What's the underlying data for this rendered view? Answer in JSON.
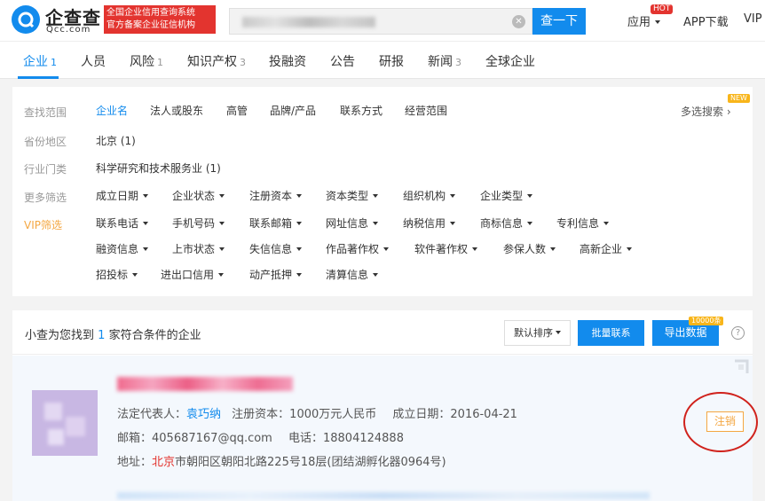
{
  "header": {
    "logo_cn": "企查查",
    "logo_en": "Qcc.com",
    "slogan_line1": "全国企业信用查询系统",
    "slogan_line2": "官方备案企业征信机构",
    "search_button": "查一下",
    "nav": {
      "app": "应用",
      "hot_badge": "HOT",
      "download": "APP下载",
      "vip": "VIP"
    }
  },
  "tabs": [
    {
      "label": "企业",
      "count": "1"
    },
    {
      "label": "人员",
      "count": ""
    },
    {
      "label": "风险",
      "count": "1"
    },
    {
      "label": "知识产权",
      "count": "3"
    },
    {
      "label": "投融资",
      "count": ""
    },
    {
      "label": "公告",
      "count": ""
    },
    {
      "label": "研报",
      "count": ""
    },
    {
      "label": "新闻",
      "count": "3"
    },
    {
      "label": "全球企业",
      "count": ""
    }
  ],
  "filters": {
    "scope_label": "查找范围",
    "scope_items": [
      "企业名",
      "法人或股东",
      "高管",
      "品牌/产品",
      "联系方式",
      "经营范围"
    ],
    "multi_search": "多选搜索",
    "new_badge": "NEW",
    "region_label": "省份地区",
    "region_value": "北京 (1)",
    "industry_label": "行业门类",
    "industry_value": "科学研究和技术服务业 (1)",
    "more_label": "更多筛选",
    "more_items": [
      "成立日期",
      "企业状态",
      "注册资本",
      "资本类型",
      "组织机构",
      "企业类型"
    ],
    "vip_label": "VIP筛选",
    "vip_row1": [
      "联系电话",
      "手机号码",
      "联系邮箱",
      "网址信息",
      "纳税信用",
      "商标信息",
      "专利信息"
    ],
    "vip_row2": [
      "融资信息",
      "上市状态",
      "失信信息",
      "作品著作权",
      "软件著作权",
      "参保人数",
      "高新企业"
    ],
    "vip_row3": [
      "招投标",
      "进出口信用",
      "动产抵押",
      "清算信息"
    ]
  },
  "results": {
    "summary_prefix": "小查为您找到",
    "summary_count": "1",
    "summary_suffix": "家符合条件的企业",
    "sort_label": "默认排序",
    "batch_label": "批量联系",
    "export_label": "导出数据",
    "export_badge": "10000条",
    "help": "?",
    "company": {
      "legal_rep_label": "法定代表人：",
      "legal_rep": "袁巧纳",
      "capital": "注册资本：1000万元人民币",
      "founded": "成立日期：2016-04-21",
      "email": "邮箱：405687167@qq.com",
      "phone": "电话：18804124888",
      "address_label": "地址：",
      "address_city": "北京",
      "address_rest": "市朝阳区朝阳北路225号18层(团结湖孵化器0964号)",
      "status": "注销"
    }
  }
}
